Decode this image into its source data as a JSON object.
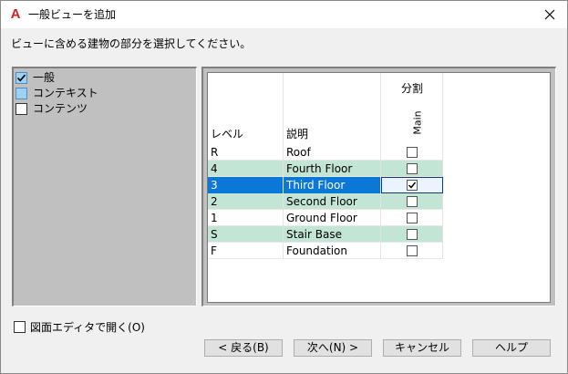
{
  "window": {
    "title": "一般ビューを追加",
    "logo_text": "A"
  },
  "instruction": "ビューに含める建物の部分を選択してください。",
  "tree": {
    "items": [
      {
        "label": "一般",
        "state": "checked"
      },
      {
        "label": "コンテキスト",
        "state": "indeterminate"
      },
      {
        "label": "コンテンツ",
        "state": "unchecked"
      }
    ]
  },
  "grid": {
    "headers": {
      "level": "レベル",
      "description": "説明",
      "split": "分割",
      "main": "Main"
    },
    "rows": [
      {
        "level": "R",
        "description": "Roof",
        "main": false
      },
      {
        "level": "4",
        "description": "Fourth Floor",
        "main": false
      },
      {
        "level": "3",
        "description": "Third Floor",
        "main": true
      },
      {
        "level": "2",
        "description": "Second Floor",
        "main": false
      },
      {
        "level": "1",
        "description": "Ground Floor",
        "main": false
      },
      {
        "level": "S",
        "description": "Stair Base",
        "main": false
      },
      {
        "level": "F",
        "description": "Foundation",
        "main": false
      }
    ],
    "selected_row": 2
  },
  "open_in_editor": {
    "label": "図面エディタで開く(O)",
    "checked": false
  },
  "buttons": {
    "back": "< 戻る(B)",
    "next": "次へ(N) >",
    "cancel": "キャンセル",
    "help": "ヘルプ"
  },
  "colors": {
    "accent": "#0b78d7",
    "alt_row": "#c2e5d5",
    "logo": "#d32020"
  }
}
